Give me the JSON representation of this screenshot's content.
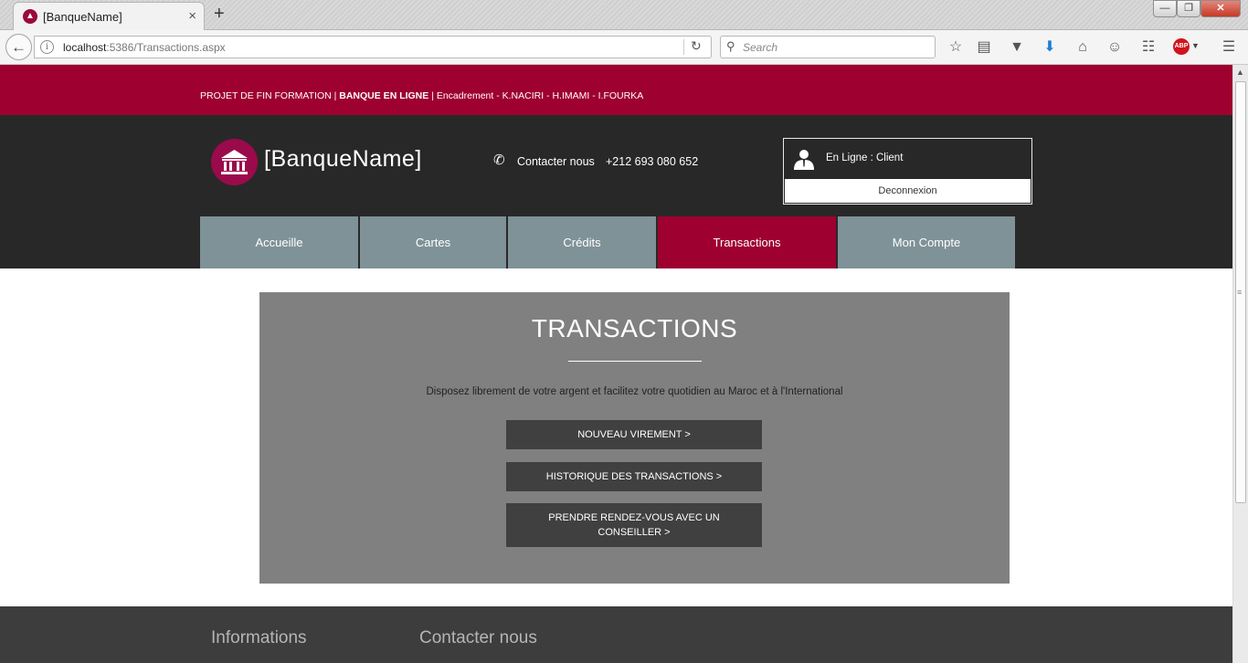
{
  "browser": {
    "tab_title": "[BanqueName]",
    "url_host": "localhost",
    "url_rest": ":5386/Transactions.aspx",
    "search_placeholder": "Search",
    "adblock_label": "ABP"
  },
  "banner": {
    "prefix": "PROJET DE FIN FORMATION | ",
    "bold": "BANQUE EN LIGNE",
    "suffix": " | Encadrement - K.NACIRI - H.IMAMI - I.FOURKA"
  },
  "header": {
    "bank_name": "[BanqueName]",
    "contact_label": "Contacter nous",
    "contact_phone": "+212 693 080 652",
    "user_status": "En Ligne : Client",
    "logout_label": "Deconnexion"
  },
  "nav": {
    "items": [
      {
        "label": "Accueille"
      },
      {
        "label": "Cartes"
      },
      {
        "label": "Crédits"
      },
      {
        "label": "Transactions"
      },
      {
        "label": "Mon Compte"
      }
    ],
    "active": "Transactions"
  },
  "hero": {
    "title": "TRANSACTIONS",
    "subtitle": "Disposez librement de votre argent et facilitez votre quotidien au Maroc et à l'International",
    "buttons": [
      {
        "label": "NOUVEAU VIREMENT >"
      },
      {
        "label": "HISTORIQUE DES TRANSACTIONS >"
      },
      {
        "label": "PRENDRE RENDEZ-VOUS AVEC UN CONSEILLER >"
      }
    ]
  },
  "footer": {
    "col1_title": "Informations",
    "col2_title": "Contacter nous"
  },
  "colors": {
    "brand": "#9e0030",
    "header_bg": "#282828",
    "nav_bg": "#7f9298",
    "hero_bg": "#808080",
    "button_bg": "#404040",
    "footer_bg": "#3d3d3d"
  }
}
